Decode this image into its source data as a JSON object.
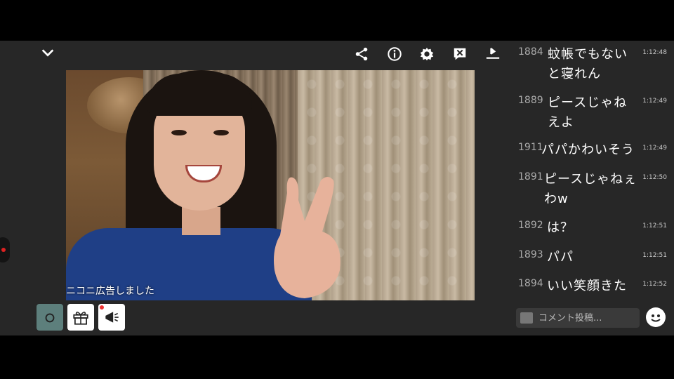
{
  "toolbar": {
    "icons": [
      "chevron-down-icon",
      "share-icon",
      "info-icon",
      "gear-icon",
      "comment-off-icon",
      "download-icon"
    ]
  },
  "video": {
    "ticker_text": "ニコニ広告しました"
  },
  "comments": [
    {
      "num": "1884",
      "lines": [
        "蚊帳でもない",
        "と寝れん"
      ],
      "time": "1:12:48"
    },
    {
      "num": "1889",
      "lines": [
        "ピースじゃね",
        "えよ"
      ],
      "time": "1:12:49"
    },
    {
      "num": "1911",
      "lines": [
        "パパかわいそう"
      ],
      "time": "1:12:49"
    },
    {
      "num": "1891",
      "lines": [
        "ピースじゃねぇ",
        "わw"
      ],
      "time": "1:12:50"
    },
    {
      "num": "1892",
      "lines": [
        "は？"
      ],
      "time": "1:12:51"
    },
    {
      "num": "1893",
      "lines": [
        "パパ"
      ],
      "time": "1:12:51"
    },
    {
      "num": "1894",
      "lines": [
        "いい笑顔きた"
      ],
      "time": "1:12:52"
    }
  ],
  "comment_input": {
    "placeholder": "コメント投稿..."
  },
  "colors": {
    "background": "#272727",
    "letterbox": "#000000",
    "comment_text": "#ffffff",
    "comment_number": "#aaaaaa"
  }
}
